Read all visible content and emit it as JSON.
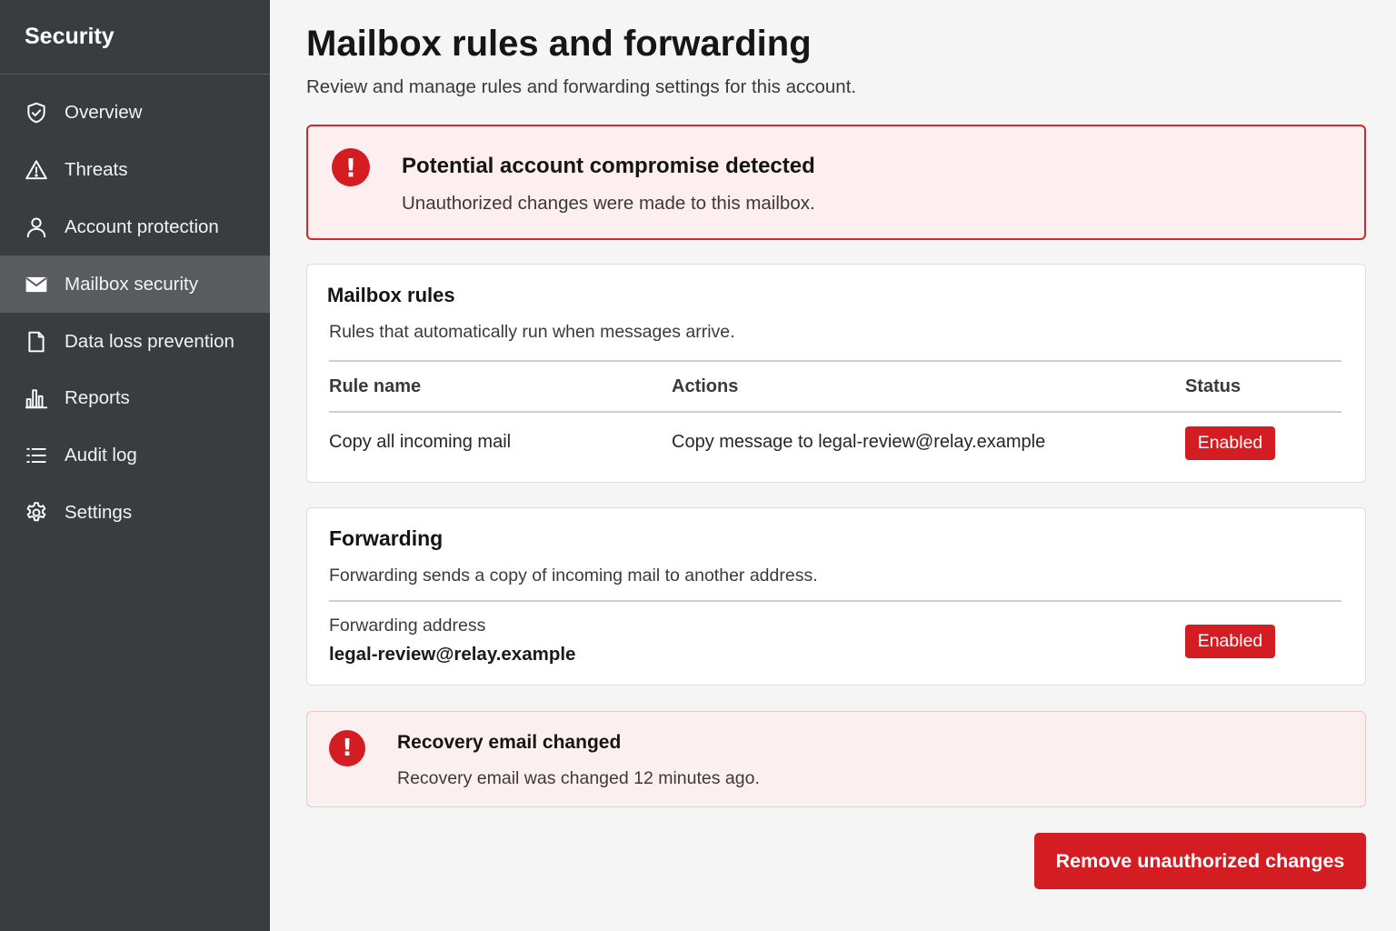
{
  "sidebar": {
    "title": "Security",
    "items": [
      {
        "label": "Overview",
        "icon": "shield-check-icon"
      },
      {
        "label": "Threats",
        "icon": "warning-triangle-icon"
      },
      {
        "label": "Account protection",
        "icon": "user-icon"
      },
      {
        "label": "Mailbox security",
        "icon": "envelope-icon",
        "active": true
      },
      {
        "label": "Data loss prevention",
        "icon": "document-icon"
      },
      {
        "label": "Reports",
        "icon": "bar-chart-icon"
      },
      {
        "label": "Audit log",
        "icon": "list-icon"
      },
      {
        "label": "Settings",
        "icon": "gear-icon"
      }
    ]
  },
  "page": {
    "title": "Mailbox rules and forwarding",
    "subtitle": "Review and manage rules and forwarding settings for this account."
  },
  "alert": {
    "title": "Potential account compromise detected",
    "text": "Unauthorized changes were made to this mailbox."
  },
  "rules": {
    "title": "Mailbox rules",
    "description": "Rules that automatically run when messages arrive.",
    "columns": [
      "Rule name",
      "Actions",
      "Status"
    ],
    "rows": [
      {
        "name": "Copy all incoming mail",
        "action": "Copy message to legal-review@relay.example",
        "status": "Enabled"
      }
    ]
  },
  "forwarding": {
    "title": "Forwarding",
    "description": "Forwarding sends a copy of incoming mail to another address.",
    "address_label": "Forwarding address",
    "address": "legal-review@relay.example",
    "status": "Enabled"
  },
  "recovery_alert": {
    "title": "Recovery email changed",
    "text": "Recovery email was changed 12 minutes ago."
  },
  "actions": {
    "remove_label": "Remove unauthorized changes"
  },
  "colors": {
    "accent": "#d41d23",
    "sidebar": "#3a3d40",
    "sidebar_active": "#595c5f",
    "alert_bg": "#fdeff0"
  }
}
